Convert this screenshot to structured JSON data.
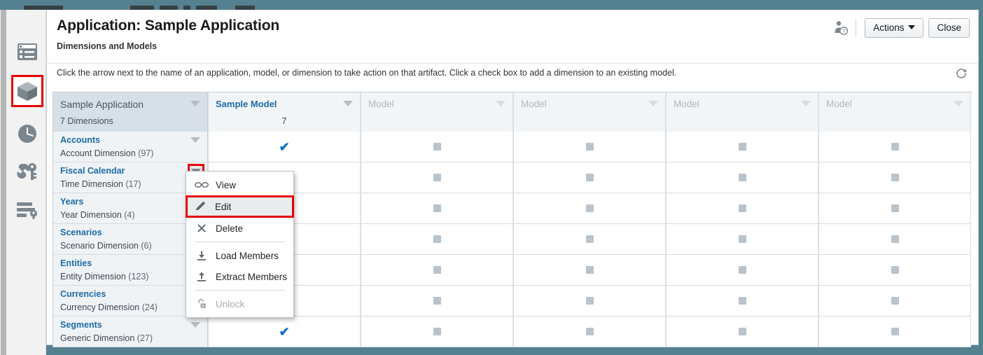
{
  "window": {
    "background_color": "#55808f"
  },
  "sidebar": {
    "items": [
      {
        "icon": "list-view-icon",
        "label": "Applications List",
        "selected": false
      },
      {
        "icon": "cube-icon",
        "label": "Dimensions and Models",
        "selected": true
      },
      {
        "icon": "clock-icon",
        "label": "Jobs",
        "selected": false
      },
      {
        "icon": "wrench-key-icon",
        "label": "Security",
        "selected": false
      },
      {
        "icon": "database-key-icon",
        "label": "Data Access",
        "selected": false
      }
    ]
  },
  "header": {
    "title": "Application: Sample Application",
    "subtitle": "Dimensions and Models",
    "user_help_icon": "user-help-icon",
    "actions_label": "Actions",
    "close_label": "Close"
  },
  "hint": {
    "text": "Click the arrow next to the name of an application, model, or dimension to take action on that artifact. Click a check box to add a dimension to an existing model.",
    "refresh_icon": "refresh-icon"
  },
  "grid": {
    "app_column": {
      "title": "Sample Application",
      "subtitle": "7  Dimensions",
      "caret_icon": "chevron-down-icon"
    },
    "model_columns": [
      {
        "title": "Sample Model",
        "count": "7",
        "empty": false,
        "caret_icon": "chevron-down-icon"
      },
      {
        "title": "Model",
        "count": "",
        "empty": true,
        "caret_icon": "chevron-down-icon"
      },
      {
        "title": "Model",
        "count": "",
        "empty": true,
        "caret_icon": "chevron-down-icon"
      },
      {
        "title": "Model",
        "count": "",
        "empty": true,
        "caret_icon": "chevron-down-icon"
      },
      {
        "title": "Model",
        "count": "",
        "empty": true,
        "caret_icon": "chevron-down-icon"
      }
    ],
    "rows": [
      {
        "name": "Accounts",
        "description": "Account Dimension",
        "count": "(97)",
        "caret": "visible",
        "caret_highlighted": false,
        "cells": [
          "check",
          "box",
          "box",
          "box",
          "box"
        ]
      },
      {
        "name": "Fiscal Calendar",
        "description": "Time Dimension",
        "count": "(17)",
        "caret": "visible",
        "caret_highlighted": true,
        "cells": [
          "check",
          "box",
          "box",
          "box",
          "box"
        ]
      },
      {
        "name": "Years",
        "description": "Year Dimension",
        "count": "(4)",
        "caret": "hidden",
        "caret_highlighted": false,
        "cells": [
          "check",
          "box",
          "box",
          "box",
          "box"
        ]
      },
      {
        "name": "Scenarios",
        "description": "Scenario Dimension",
        "count": "(6)",
        "caret": "hidden",
        "caret_highlighted": false,
        "cells": [
          "check",
          "box",
          "box",
          "box",
          "box"
        ]
      },
      {
        "name": "Entities",
        "description": "Entity Dimension",
        "count": "(123)",
        "caret": "hidden",
        "caret_highlighted": false,
        "cells": [
          "check",
          "box",
          "box",
          "box",
          "box"
        ]
      },
      {
        "name": "Currencies",
        "description": "Currency Dimension",
        "count": "(24)",
        "caret": "hidden",
        "caret_highlighted": false,
        "cells": [
          "check",
          "box",
          "box",
          "box",
          "box"
        ]
      },
      {
        "name": "Segments",
        "description": "Generic Dimension",
        "count": "(27)",
        "caret": "visible",
        "caret_highlighted": false,
        "cells": [
          "check",
          "box",
          "box",
          "box",
          "box"
        ]
      }
    ]
  },
  "context_menu": {
    "items": [
      {
        "label": "View",
        "icon": "glasses-icon",
        "selected": false,
        "disabled": false,
        "separator_after": false
      },
      {
        "label": "Edit",
        "icon": "pencil-icon",
        "selected": true,
        "disabled": false,
        "separator_after": false
      },
      {
        "label": "Delete",
        "icon": "close-x-icon",
        "selected": false,
        "disabled": false,
        "separator_after": true
      },
      {
        "label": "Load Members",
        "icon": "download-icon",
        "selected": false,
        "disabled": false,
        "separator_after": false
      },
      {
        "label": "Extract Members",
        "icon": "upload-icon",
        "selected": false,
        "disabled": false,
        "separator_after": true
      },
      {
        "label": "Unlock",
        "icon": "padlock-locked-icon",
        "selected": false,
        "disabled": true,
        "separator_after": false
      }
    ]
  },
  "colors": {
    "highlight": "#e60000",
    "link": "#1b6ca8",
    "check": "#1570c2",
    "chrome": "#55808f"
  }
}
